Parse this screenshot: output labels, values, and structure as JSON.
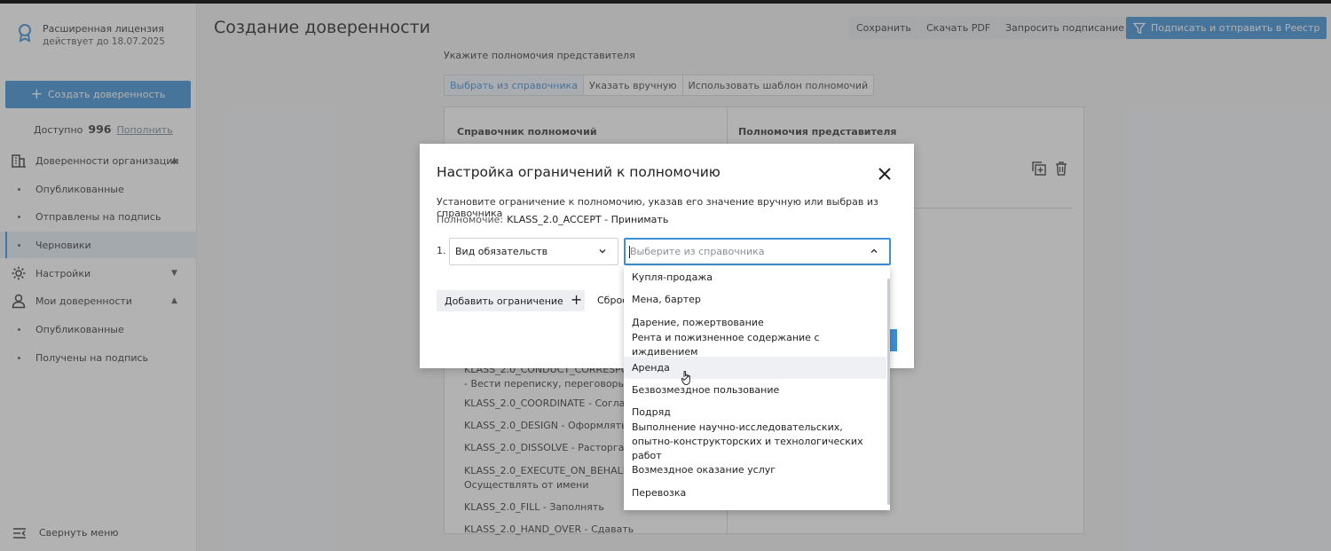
{
  "sidebar": {
    "license_title": "Расширенная лицензия",
    "license_sub": "действует до 18.07.2025",
    "create_label": "Создать доверенность",
    "available_label": "Доступно",
    "available_count": "996",
    "topup_label": "Пополнить",
    "items": [
      {
        "label": "Доверенности организации",
        "icon": "building-icon"
      },
      {
        "label": "Опубликованные"
      },
      {
        "label": "Отправлены на подпись"
      },
      {
        "label": "Черновики"
      },
      {
        "label": "Настройки",
        "icon": "gear-icon"
      },
      {
        "label": "Мои доверенности",
        "icon": "user-icon"
      },
      {
        "label": "Опубликованные"
      },
      {
        "label": "Получены на подпись"
      }
    ],
    "collapse_label": "Свернуть меню"
  },
  "header": {
    "title": "Создание доверенности",
    "save_label": "Сохранить",
    "pdf_label": "Скачать PDF",
    "request_label": "Запросить подписание",
    "sign_label": "Подписать и отправить в Реестр"
  },
  "main": {
    "section_label": "Укажите полномочия представителя",
    "tabs": [
      "Выбрать из справочника",
      "Указать вручную",
      "Использовать шаблон полномочий"
    ],
    "col_left": "Справочник полномочий",
    "col_right": "Полномочия представителя",
    "authorities": [
      "KLASS_2.0_CONDUCT_CORRESPONDENCE",
      "- Вести переписку, переговоры",
      "KLASS_2.0_COORDINATE - Согласовывать",
      "KLASS_2.0_DESIGN - Оформлять",
      "KLASS_2.0_DISSOLVE - Расторгать",
      "KLASS_2.0_EXECUTE_ON_BEHALF_OF",
      "Осуществлять от имени",
      "KLASS_2.0_FILL - Заполнять",
      "KLASS_2.0_HAND_OVER - Сдавать"
    ]
  },
  "modal": {
    "title": "Настройка ограничений к полномочию",
    "description": "Установите ограничение к полномочию, указав его значение вручную или выбрав из справочника",
    "authority_label": "Полномочие:",
    "authority_value": "KLASS_2.0_ACCEPT - Принимать",
    "row_number": "1.",
    "type_value": "Вид обязательств",
    "value_placeholder": "Выберите из справочника",
    "add_label": "Добавить ограничение",
    "reset_label": "Сбросить"
  },
  "dropdown": {
    "options": [
      "Купля-продажа",
      "Мена, бартер",
      "Дарение, пожертвование",
      "Рента и пожизненное содержание с иждивением",
      "Аренда",
      "Безвозмездное пользование",
      "Подряд",
      "Выполнение научно-исследовательских, опытно-конструкторских и технологических работ",
      "Возмездное оказание услуг",
      "Перевозка"
    ],
    "hovered": "Аренда"
  },
  "colors": {
    "accent": "#3d8fd6",
    "overlay": "#555555"
  }
}
